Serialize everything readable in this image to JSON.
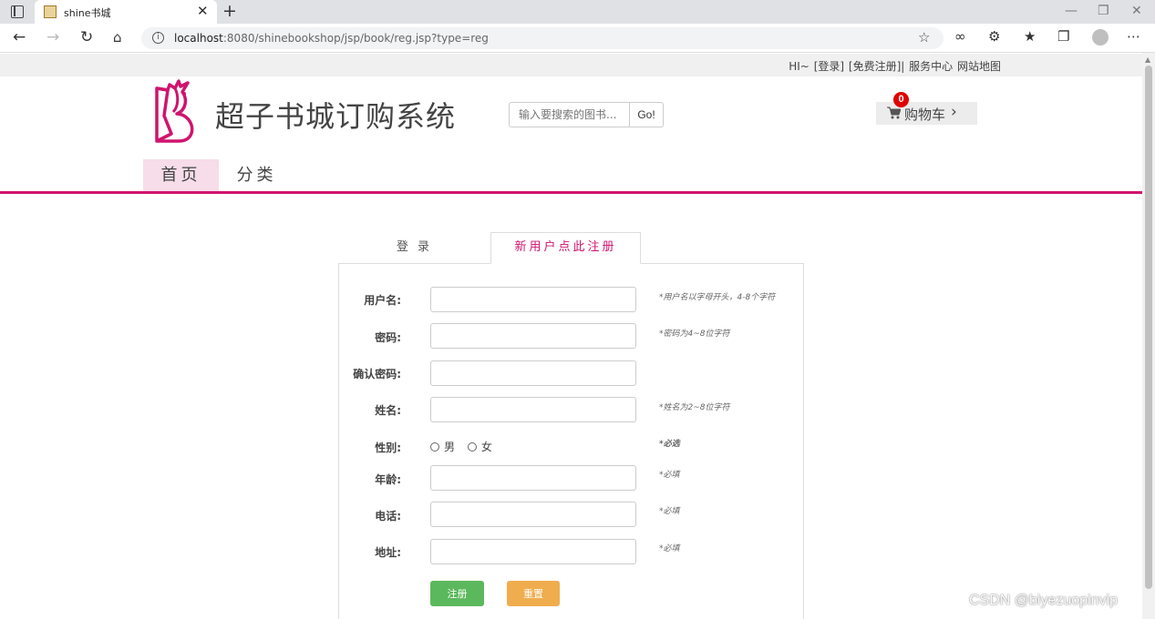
{
  "browser": {
    "tab_title": "shine书城",
    "tab_close": "✕",
    "new_tab": "+",
    "url_host": "localhost",
    "url_path": ":8080/shinebookshop/jsp/book/reg.jsp?type=reg",
    "min": "—",
    "restore": "❐",
    "close": "✕"
  },
  "topbar": {
    "greeting": "HI~",
    "login": "[登录]",
    "register": "[免费注册]|",
    "service": "服务中心",
    "sitemap": "网站地图"
  },
  "header": {
    "site_title": "超子书城订购系统",
    "search_placeholder": "输入要搜索的图书...",
    "search_button": "Go!",
    "cart_label": "购物车",
    "cart_count": "0"
  },
  "nav": {
    "home": "首页",
    "category": "分类"
  },
  "form": {
    "tab_login": "登 录",
    "tab_register": "新用户点此注册",
    "fields": [
      {
        "label": "用户名:",
        "hint": "*用户名以字母开头，4-8个字符"
      },
      {
        "label": "密码:",
        "hint": "*密码为4~8位字符"
      },
      {
        "label": "确认密码:",
        "hint": ""
      },
      {
        "label": "姓名:",
        "hint": "*姓名为2~8位字符"
      },
      {
        "label": "性别:",
        "hint": "*必选"
      },
      {
        "label": "年龄:",
        "hint": "*必填"
      },
      {
        "label": "电话:",
        "hint": "*必填"
      },
      {
        "label": "地址:",
        "hint": "*必填"
      }
    ],
    "gender_male": "男",
    "gender_female": "女",
    "submit": "注册",
    "reset": "重置"
  },
  "watermark": "CSDN @biyezuopinvip",
  "colors": {
    "brand": "#d0146e",
    "submit": "#5cb85c",
    "reset": "#f0ad4e",
    "badge": "#e00000"
  }
}
